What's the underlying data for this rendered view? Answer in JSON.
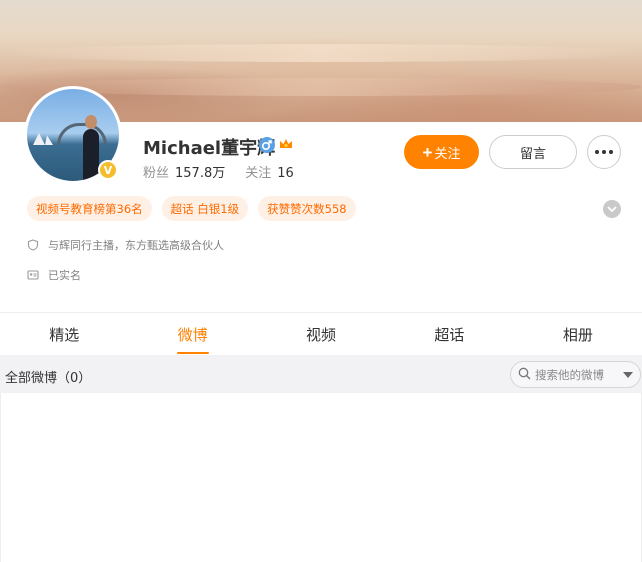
{
  "profile": {
    "name": "Michael董宇辉",
    "fans_label": "粉丝",
    "fans_count": "157.8万",
    "following_label": "关注",
    "following_count": "16",
    "verified_mark": "V"
  },
  "actions": {
    "follow_label": "关注",
    "follow_icon": "+",
    "message_label": "留言"
  },
  "tags": [
    "视频号教育榜第36名",
    "超话 白银1级",
    "获赞赞次数558"
  ],
  "info": {
    "line1": "与辉同行主播，东方甄选高级合伙人",
    "line2": "已实名"
  },
  "tabs": [
    "精选",
    "微博",
    "视频",
    "超话",
    "相册"
  ],
  "active_tab": "微博",
  "feed": {
    "title": "全部微博（0）",
    "search_placeholder": "搜索他的微博"
  },
  "colors": {
    "accent": "#ff8200",
    "tag_bg": "#fff0e5",
    "tag_text": "#ff6a00",
    "verify_badge": "#f4bd2f",
    "male_icon": "#5aa0e6"
  }
}
